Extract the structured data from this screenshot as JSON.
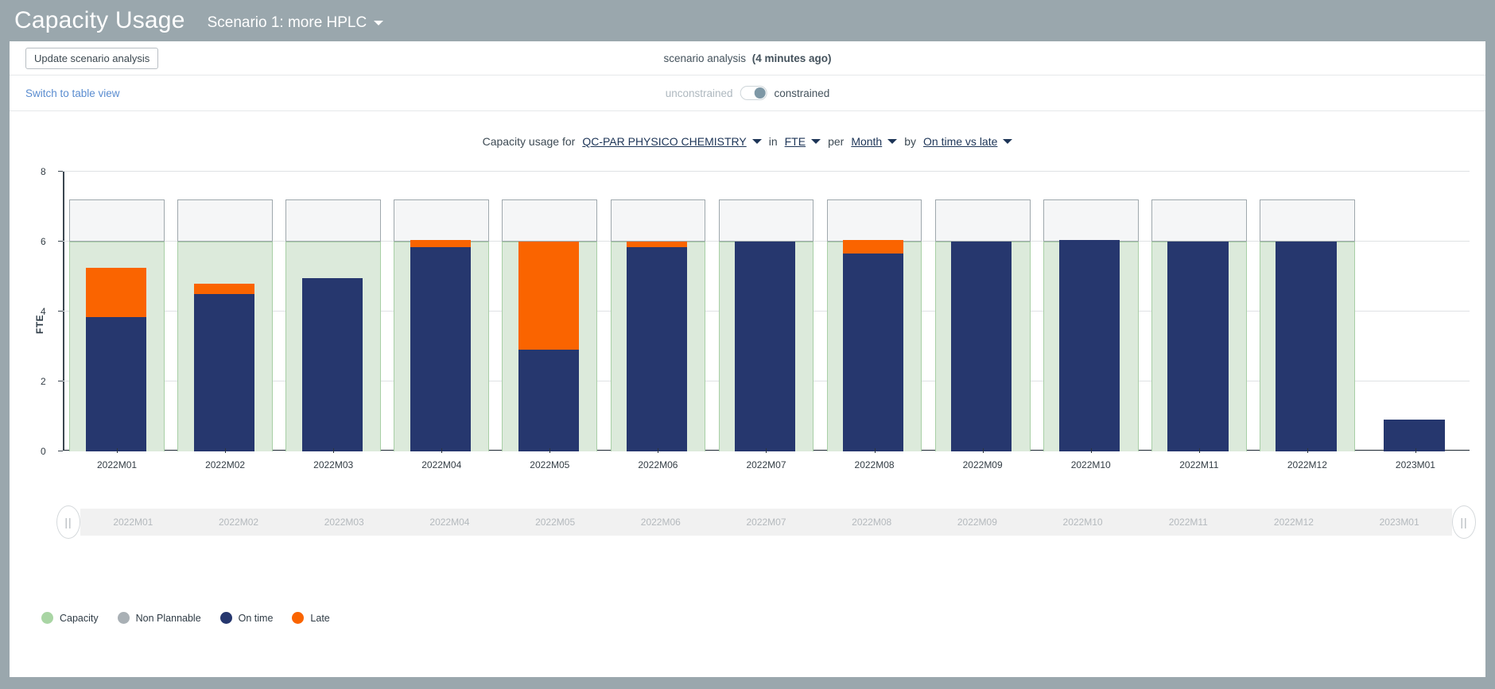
{
  "header": {
    "title": "Capacity Usage",
    "scenario_label": "Scenario 1: more HPLC"
  },
  "toolbar": {
    "update_button": "Update scenario analysis",
    "status_prefix": "scenario analysis",
    "status_age": "(4 minutes ago)"
  },
  "viewmode": {
    "switch_link": "Switch to table view",
    "toggle_left": "unconstrained",
    "toggle_right": "constrained",
    "toggle_state": "constrained"
  },
  "config": {
    "prefix": "Capacity usage for",
    "resource": "QC-PAR PHYSICO CHEMISTRY",
    "in_label": "in",
    "unit": "FTE",
    "per_label": "per",
    "period": "Month",
    "by_label": "by",
    "grouping": "On time vs late"
  },
  "legend": [
    {
      "label": "Capacity",
      "color": "#a9d5a4"
    },
    {
      "label": "Non Plannable",
      "color": "#a9b0b5"
    },
    {
      "label": "On time",
      "color": "#26376e"
    },
    {
      "label": "Late",
      "color": "#fa6400"
    }
  ],
  "chart_data": {
    "type": "bar",
    "subtype": "stacked-bar-with-capacity-band",
    "title": "Capacity usage for QC-PAR PHYSICO CHEMISTRY in FTE per Month by On time vs late",
    "xlabel": "",
    "ylabel": "FTE",
    "ylim": [
      0,
      8
    ],
    "yticks": [
      0,
      2,
      4,
      6,
      8
    ],
    "grid": true,
    "legend_position": "bottom-left",
    "categories": [
      "2022M01",
      "2022M02",
      "2022M03",
      "2022M04",
      "2022M05",
      "2022M06",
      "2022M07",
      "2022M08",
      "2022M09",
      "2022M10",
      "2022M11",
      "2022M12",
      "2023M01"
    ],
    "series": [
      {
        "name": "On time",
        "color": "#26376e",
        "values": [
          3.85,
          4.5,
          4.95,
          5.85,
          2.9,
          5.85,
          6.0,
          5.65,
          6.0,
          6.05,
          6.0,
          6.0,
          0.9
        ]
      },
      {
        "name": "Late",
        "color": "#fa6400",
        "values": [
          1.4,
          0.3,
          0.0,
          0.2,
          3.1,
          0.15,
          0.0,
          0.4,
          0.0,
          0.0,
          0.0,
          0.0,
          0.0
        ]
      },
      {
        "name": "Capacity",
        "color": "#dceadb",
        "values": [
          6.0,
          6.0,
          6.0,
          6.0,
          6.0,
          6.0,
          6.0,
          6.0,
          6.0,
          6.0,
          6.0,
          6.0,
          0
        ]
      },
      {
        "name": "Non Plannable",
        "color": "#f5f6f7",
        "values": [
          1.2,
          1.2,
          1.2,
          1.2,
          1.2,
          1.2,
          1.2,
          1.2,
          1.2,
          1.2,
          1.2,
          1.2,
          0
        ]
      }
    ]
  },
  "range_slider": {
    "labels": [
      "2022M01",
      "2022M02",
      "2022M03",
      "2022M04",
      "2022M05",
      "2022M06",
      "2022M07",
      "2022M08",
      "2022M09",
      "2022M10",
      "2022M11",
      "2022M12",
      "2023M01"
    ],
    "handle_glyph": "||"
  }
}
